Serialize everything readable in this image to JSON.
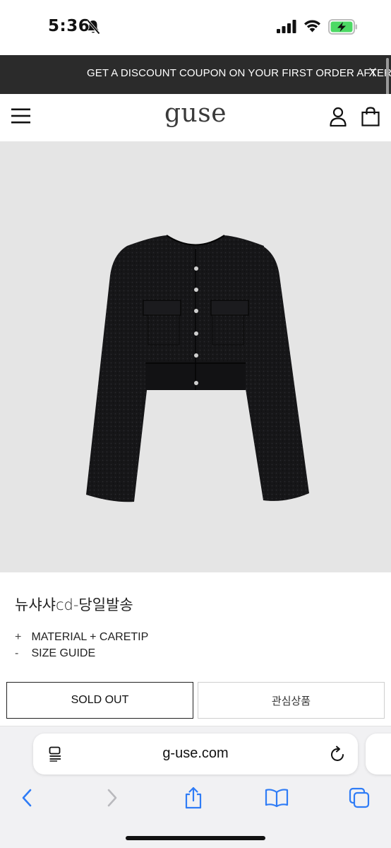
{
  "status_bar": {
    "time": "5:36"
  },
  "promo": {
    "text": "GET A DISCOUNT COUPON ON YOUR FIRST ORDER AFTER S",
    "close_label": "X"
  },
  "header": {
    "logo": "guse"
  },
  "product": {
    "name": "뉴샤샤cd-당일발송",
    "details": [
      {
        "symbol": "+",
        "label": "MATERIAL + CARETIP"
      },
      {
        "symbol": "-",
        "label": "SIZE GUIDE"
      }
    ],
    "sold_out_label": "SOLD OUT",
    "wishlist_label": "관심상품"
  },
  "browser": {
    "url": "g-use.com"
  },
  "icons": {
    "menu": "hamburger-menu-icon",
    "account": "user-icon",
    "cart": "shopping-bag-icon",
    "back": "chevron-left-icon",
    "forward": "chevron-right-icon",
    "share": "share-icon",
    "bookmarks": "book-icon",
    "tabs": "tabs-icon"
  },
  "colors": {
    "promo_background": "#2b2b2b",
    "image_background": "#e5e5e5",
    "browser_accent": "#2f7cf6",
    "battery_green": "#4cd964"
  }
}
